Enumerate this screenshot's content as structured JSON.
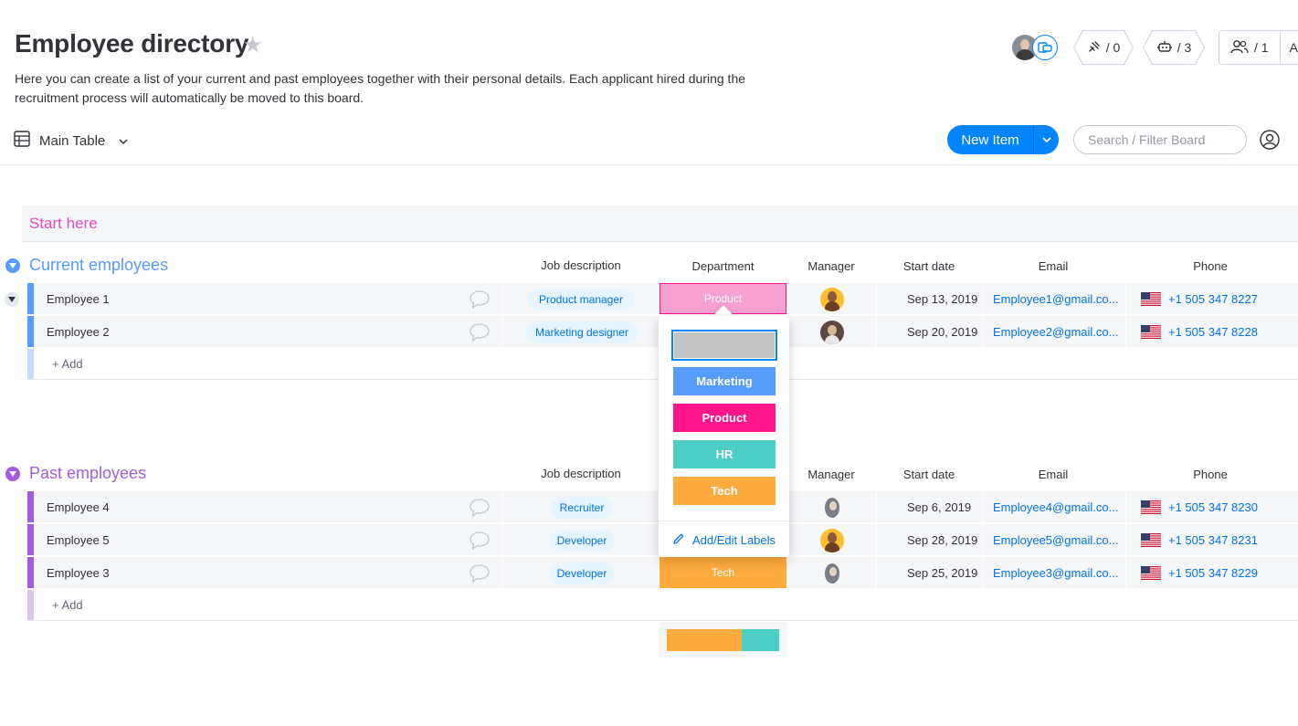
{
  "header": {
    "title": "Employee directory",
    "description": "Here you can create a list of your current and past employees together with their personal details. Each applicant hired during the recruitment process will automatically be moved to this board.",
    "integrations_count": "/ 0",
    "automations_count": "/ 3",
    "members_count": "/ 1",
    "activity_label": "Ac"
  },
  "toolbar": {
    "view_label": "Main Table",
    "new_item_label": "New Item",
    "search_placeholder": "Search / Filter Board"
  },
  "start_group": {
    "title": "Start here"
  },
  "columns": {
    "job": "Job description",
    "department": "Department",
    "manager": "Manager",
    "start_date": "Start date",
    "email": "Email",
    "phone": "Phone"
  },
  "groups": [
    {
      "title": "Current employees",
      "color": "#579bfc",
      "add_label": "+ Add",
      "rows": [
        {
          "name": "Employee 1",
          "job": "Product manager",
          "department": "Product",
          "dept_color": "#f7a1d2",
          "start_date": "Sep 13, 2019",
          "email": "Employee1@gmail.co...",
          "phone": "+1 505 347 8227"
        },
        {
          "name": "Employee 2",
          "job": "Marketing designer",
          "department": "",
          "dept_color": "#f5f6f8",
          "start_date": "Sep 20, 2019",
          "email": "Employee2@gmail.co...",
          "phone": "+1 505 347 8228"
        }
      ]
    },
    {
      "title": "Past employees",
      "color": "#a25ddc",
      "add_label": "+ Add",
      "rows": [
        {
          "name": "Employee 4",
          "job": "Recruiter",
          "department": "",
          "dept_color": "#f5f6f8",
          "start_date": "Sep 6, 2019",
          "email": "Employee4@gmail.co...",
          "phone": "+1 505 347 8230"
        },
        {
          "name": "Employee 5",
          "job": "Developer",
          "department": "",
          "dept_color": "#f5f6f8",
          "start_date": "Sep 28, 2019",
          "email": "Employee5@gmail.co...",
          "phone": "+1 505 347 8231"
        },
        {
          "name": "Employee 3",
          "job": "Developer",
          "department": "Tech",
          "dept_color": "#fdab3d",
          "start_date": "Sep 25, 2019",
          "email": "Employee3@gmail.co...",
          "phone": "+1 505 347 8229"
        }
      ]
    }
  ],
  "label_dropdown": {
    "options": [
      {
        "label": "",
        "color": "#c4c4c4"
      },
      {
        "label": "Marketing",
        "color": "#579bfc"
      },
      {
        "label": "Product",
        "color": "#ff158a"
      },
      {
        "label": "HR",
        "color": "#4eccc6"
      },
      {
        "label": "Tech",
        "color": "#fdab3d"
      }
    ],
    "edit_label": "Add/Edit Labels"
  },
  "summary_colors": [
    "#fdab3d",
    "#4eccc6"
  ]
}
